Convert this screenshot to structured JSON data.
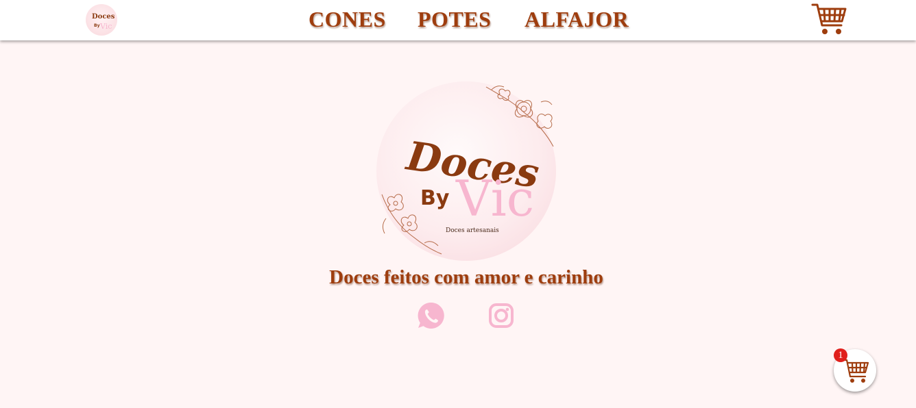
{
  "header": {
    "logo_text": [
      "Doces",
      "By",
      "Vic"
    ],
    "nav": [
      {
        "label": "CONES"
      },
      {
        "label": "POTES"
      },
      {
        "label": "ALFAJOR"
      }
    ],
    "cart_icon": "shopping-cart-icon"
  },
  "hero": {
    "logo": {
      "line1": "Doces",
      "line2": "By",
      "line3": "Vic",
      "subtitle": "Doces artesanais"
    },
    "tagline": "Doces feitos com amor e carinho",
    "social": [
      {
        "icon": "whatsapp-icon"
      },
      {
        "icon": "instagram-icon"
      }
    ]
  },
  "floating_cart": {
    "icon": "shopping-cart-icon",
    "count": "1"
  },
  "colors": {
    "brand_brown": "#9e3d0e",
    "brand_pink": "#f7b6cf",
    "background": "#fff5f5",
    "badge": "#e0201c"
  }
}
